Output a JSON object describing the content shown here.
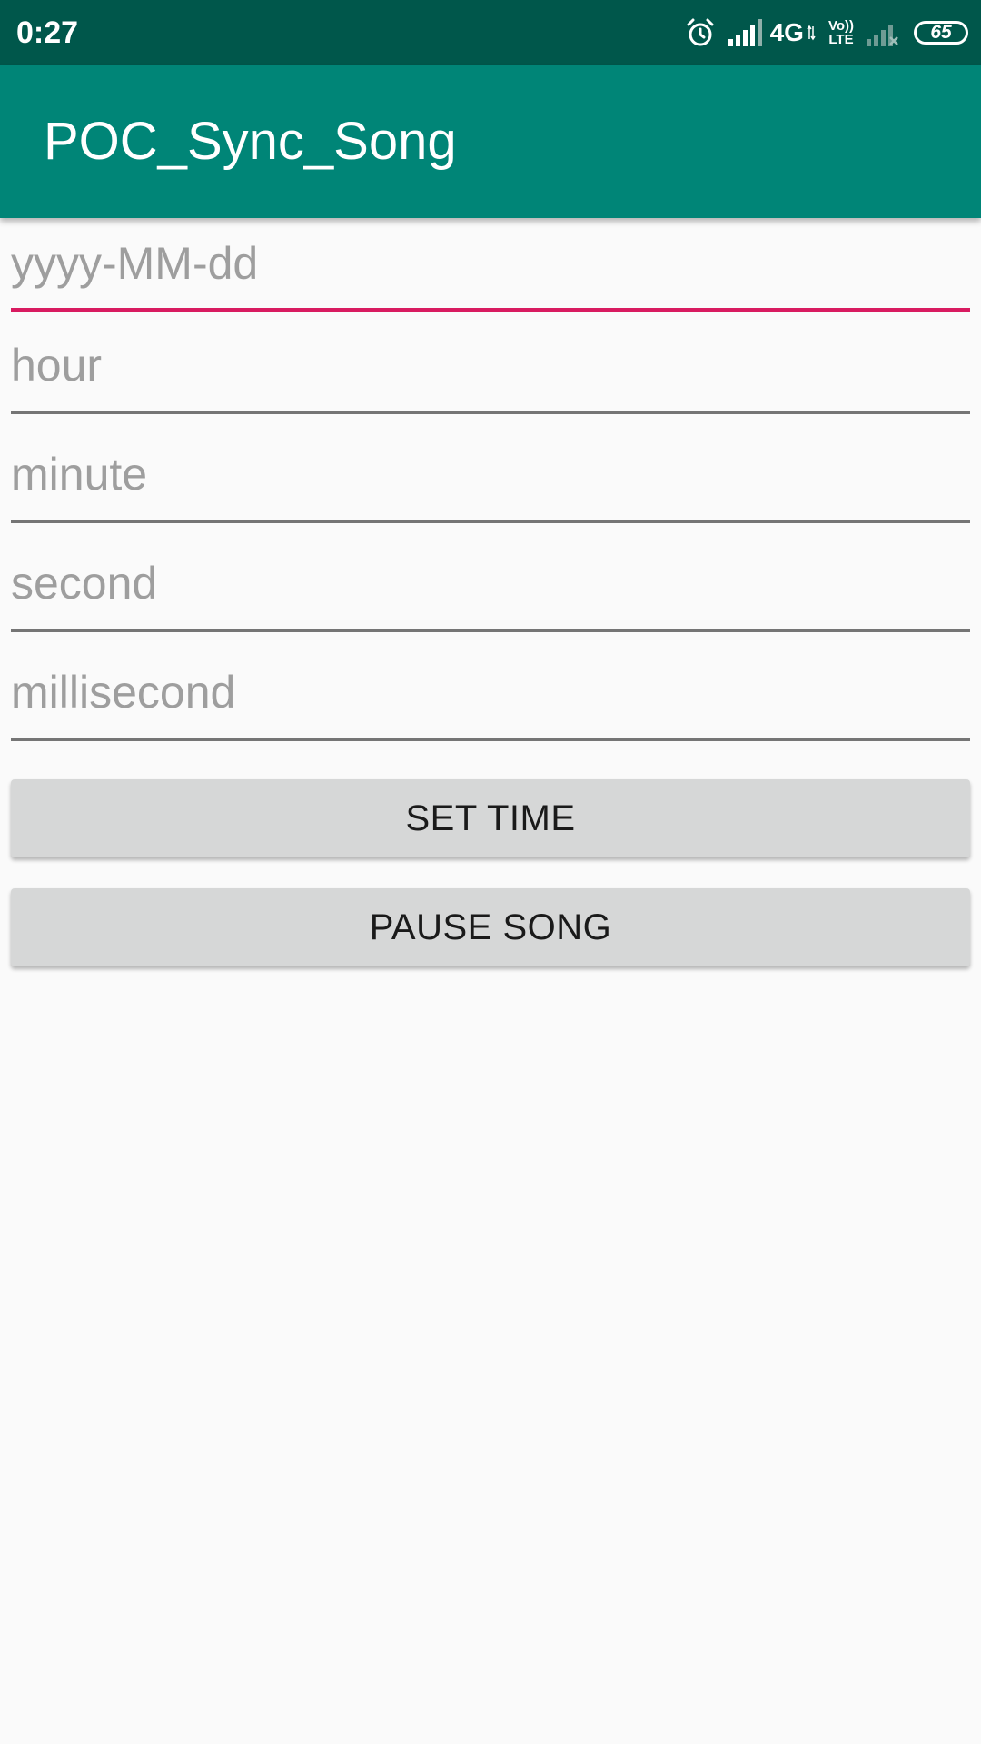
{
  "status_bar": {
    "time": "0:27",
    "network_label": "4G",
    "volte_top": "Vo))",
    "volte_bottom": "LTE",
    "battery_level": "65",
    "icons": [
      "alarm-icon",
      "signal-icon",
      "volte-icon",
      "signal-no-service-icon",
      "battery-icon"
    ]
  },
  "app_bar": {
    "title": "POC_Sync_Song",
    "background_color": "#008577",
    "status_bar_color": "#00574b"
  },
  "form": {
    "fields": [
      {
        "name": "date",
        "placeholder": "yyyy-MM-dd",
        "value": "",
        "focused": true
      },
      {
        "name": "hour",
        "placeholder": "hour",
        "value": "",
        "focused": false
      },
      {
        "name": "minute",
        "placeholder": "minute",
        "value": "",
        "focused": false
      },
      {
        "name": "second",
        "placeholder": "second",
        "value": "",
        "focused": false
      },
      {
        "name": "millisecond",
        "placeholder": "millisecond",
        "value": "",
        "focused": false
      }
    ],
    "accent_color": "#d81b60"
  },
  "buttons": {
    "set_time": "SET TIME",
    "pause_song": "PAUSE SONG"
  }
}
